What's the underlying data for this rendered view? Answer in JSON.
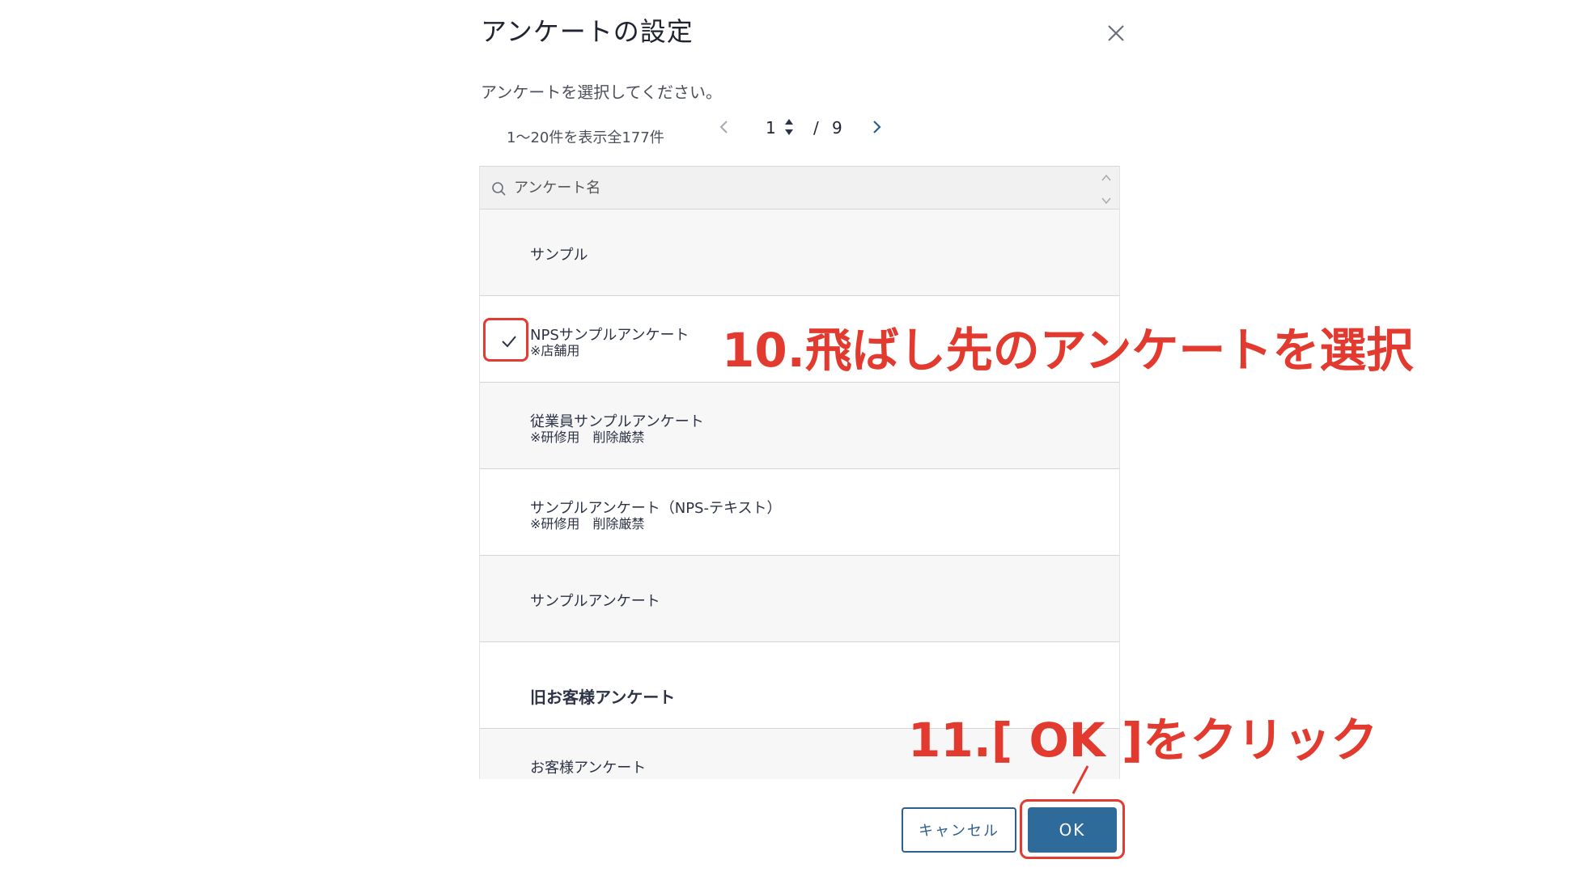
{
  "dialog": {
    "title": "アンケートの設定",
    "instruction": "アンケートを選択してください。"
  },
  "pagination": {
    "range_text": "1〜20件を表示全177件",
    "current_page": "1",
    "separator": "/",
    "total_pages": "9"
  },
  "search": {
    "placeholder": "アンケート名"
  },
  "surveys": [
    {
      "name": "サンプル",
      "sub": ""
    },
    {
      "name": "NPSサンプルアンケート",
      "sub": "※店舗用",
      "selected": true
    },
    {
      "name": "従業員サンプルアンケート",
      "sub": "※研修用　削除厳禁"
    },
    {
      "name": "サンプルアンケート（NPS-テキスト）",
      "sub": "※研修用　削除厳禁"
    },
    {
      "name": "サンプルアンケート",
      "sub": ""
    },
    {
      "name": "旧お客様アンケート",
      "sub": ""
    },
    {
      "name": "お客様アンケート",
      "sub": ""
    }
  ],
  "buttons": {
    "cancel": "キャンセル",
    "ok": "OK"
  },
  "annotations": {
    "step10": "10.飛ばし先のアンケートを選択",
    "step11": "11.[ OK ]をクリック",
    "color": "#e23a2f"
  },
  "icons": [
    "close-icon",
    "chevron-left-icon",
    "chevron-right-icon",
    "spinner-icon",
    "search-icon",
    "sort-up-icon",
    "sort-down-icon",
    "check-icon"
  ],
  "colors": {
    "primary": "#2e6b9a",
    "cancel_border": "#2e5f8e",
    "highlight": "#e43a30"
  }
}
